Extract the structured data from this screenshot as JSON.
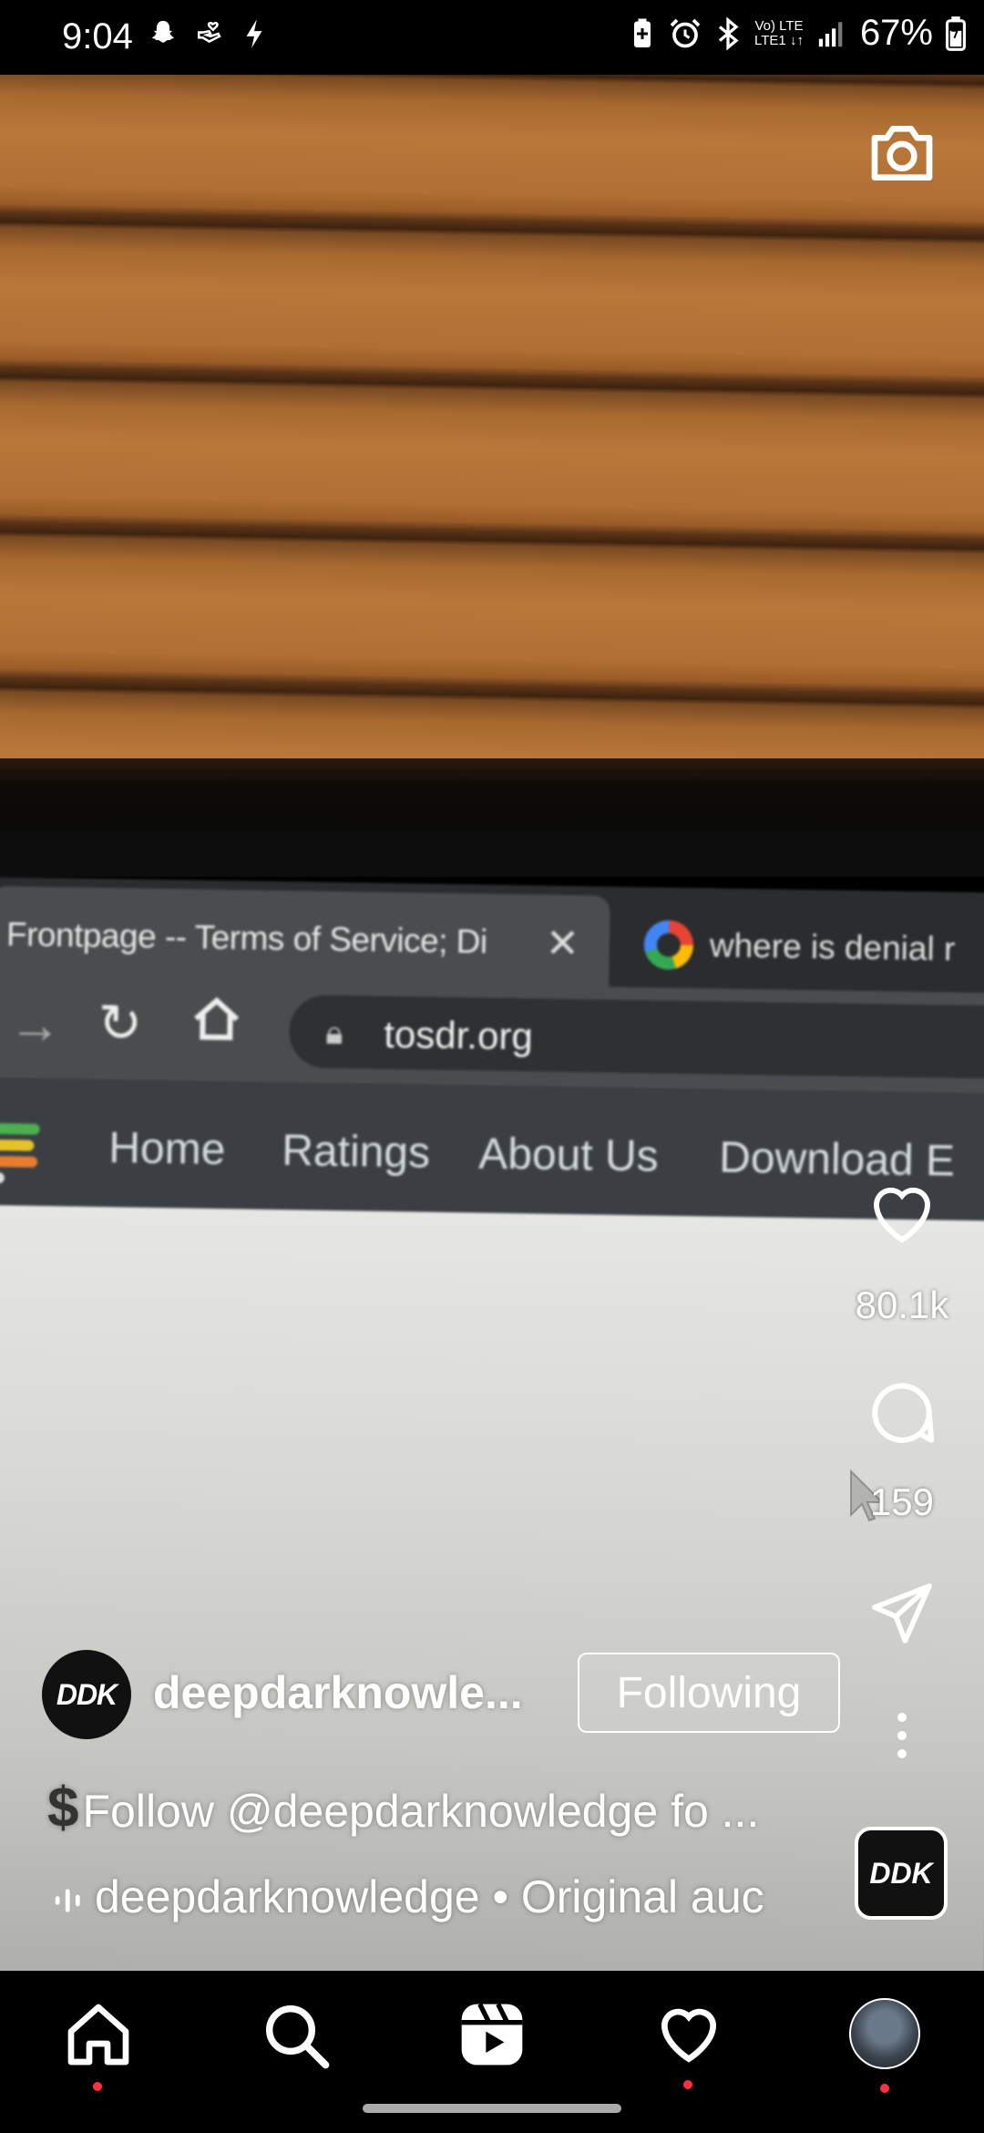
{
  "status_bar": {
    "time": "9:04",
    "battery_text": "67%",
    "network_top": "Vo) LTE",
    "network_bottom": "LTE1 ↓↑",
    "icons": [
      "snapchat-icon",
      "hand-heart-icon",
      "flash-icon",
      "battery-saver-icon",
      "alarm-icon",
      "bluetooth-icon",
      "signal-icon",
      "battery-icon"
    ]
  },
  "video": {
    "browser": {
      "active_tab_title": "Frontpage -- Terms of Service; Di",
      "tab_close": "✕",
      "second_tab_title": "where is denial r",
      "url": "tosdr.org",
      "site_nav": [
        "Home",
        "Ratings",
        "About Us",
        "Download E"
      ]
    }
  },
  "actions": {
    "likes": "80.1k",
    "comments": "159"
  },
  "post": {
    "avatar_text": "DDK",
    "username": "deepdarknowle...",
    "follow_label": "Following",
    "caption_symbol": "$",
    "caption": "Follow @deepdarknowledge fo ...",
    "audio": "deepdarknowledge • Original auc",
    "audio_thumb_text": "DDK"
  },
  "colors": {
    "notification_dot": "#ff3040",
    "background": "#000000"
  }
}
